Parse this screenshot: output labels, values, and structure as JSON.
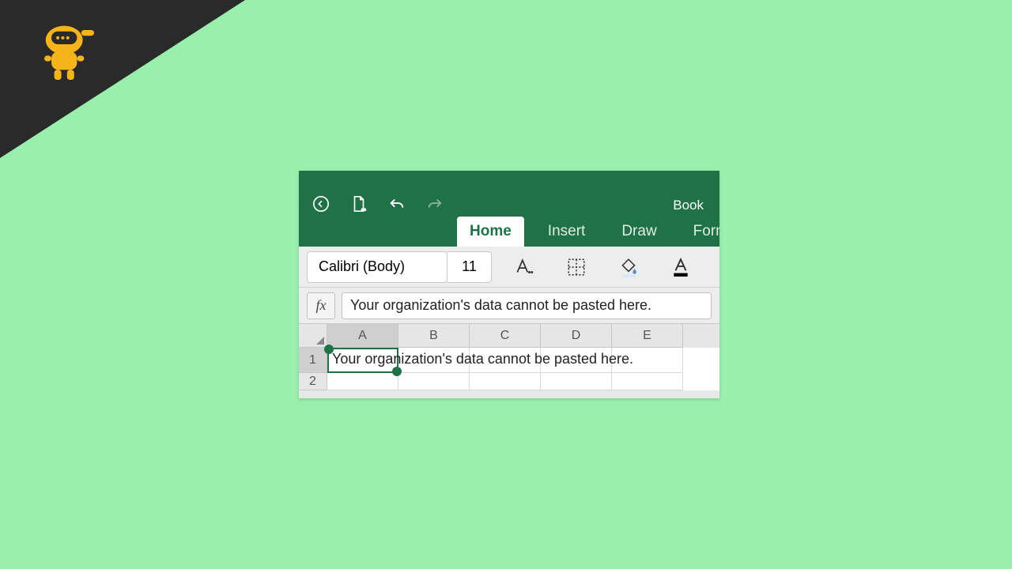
{
  "titlebar": {
    "document_name": "Book"
  },
  "ribbon": {
    "tabs": [
      {
        "label": "Home",
        "active": true
      },
      {
        "label": "Insert",
        "active": false
      },
      {
        "label": "Draw",
        "active": false
      },
      {
        "label": "Formulas",
        "active": false
      }
    ]
  },
  "format": {
    "font_name": "Calibri (Body)",
    "font_size": "11"
  },
  "formula_bar": {
    "fx_label": "fx",
    "content": "Your organization's data cannot be pasted here."
  },
  "grid": {
    "columns": [
      "A",
      "B",
      "C",
      "D",
      "E"
    ],
    "rows": [
      "1",
      "2"
    ],
    "active_cell": "A1",
    "cell_a1": "Your organization's data cannot be pasted here."
  },
  "colors": {
    "page_bg": "#99f0ad",
    "excel_green": "#1f7246"
  }
}
